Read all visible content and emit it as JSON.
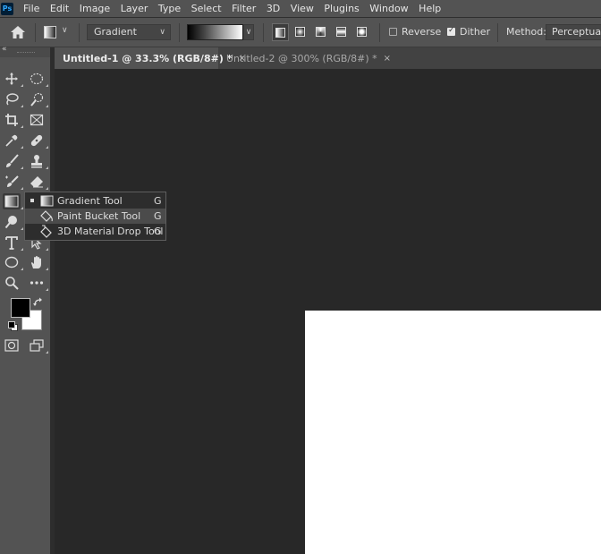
{
  "app": {
    "logo_text": "Ps"
  },
  "menu": [
    "File",
    "Edit",
    "Image",
    "Layer",
    "Type",
    "Select",
    "Filter",
    "3D",
    "View",
    "Plugins",
    "Window",
    "Help"
  ],
  "options_bar": {
    "mode_value": "Gradient",
    "reverse_label": "Reverse",
    "reverse_checked": false,
    "dither_label": "Dither",
    "dither_checked": true,
    "method_label": "Method:",
    "method_value": "Perceptual"
  },
  "tabs": [
    {
      "label": "Untitled-1 @ 33.3% (RGB/8#) *",
      "active": true
    },
    {
      "label": "Untitled-2 @ 300% (RGB/8#) *",
      "active": false
    }
  ],
  "flyout": {
    "items": [
      {
        "label": "Gradient Tool",
        "shortcut": "G",
        "selected": true,
        "icon": "gradient-icon"
      },
      {
        "label": "Paint Bucket Tool",
        "shortcut": "G",
        "selected": false,
        "icon": "paint-bucket-icon"
      },
      {
        "label": "3D Material Drop Tool",
        "shortcut": "G",
        "selected": false,
        "icon": "3d-material-drop-icon"
      }
    ]
  },
  "colors": {
    "foreground": "#000000",
    "background": "#ffffff",
    "panel": "#535353",
    "workspace": "#282828"
  },
  "close_glyph": "×"
}
